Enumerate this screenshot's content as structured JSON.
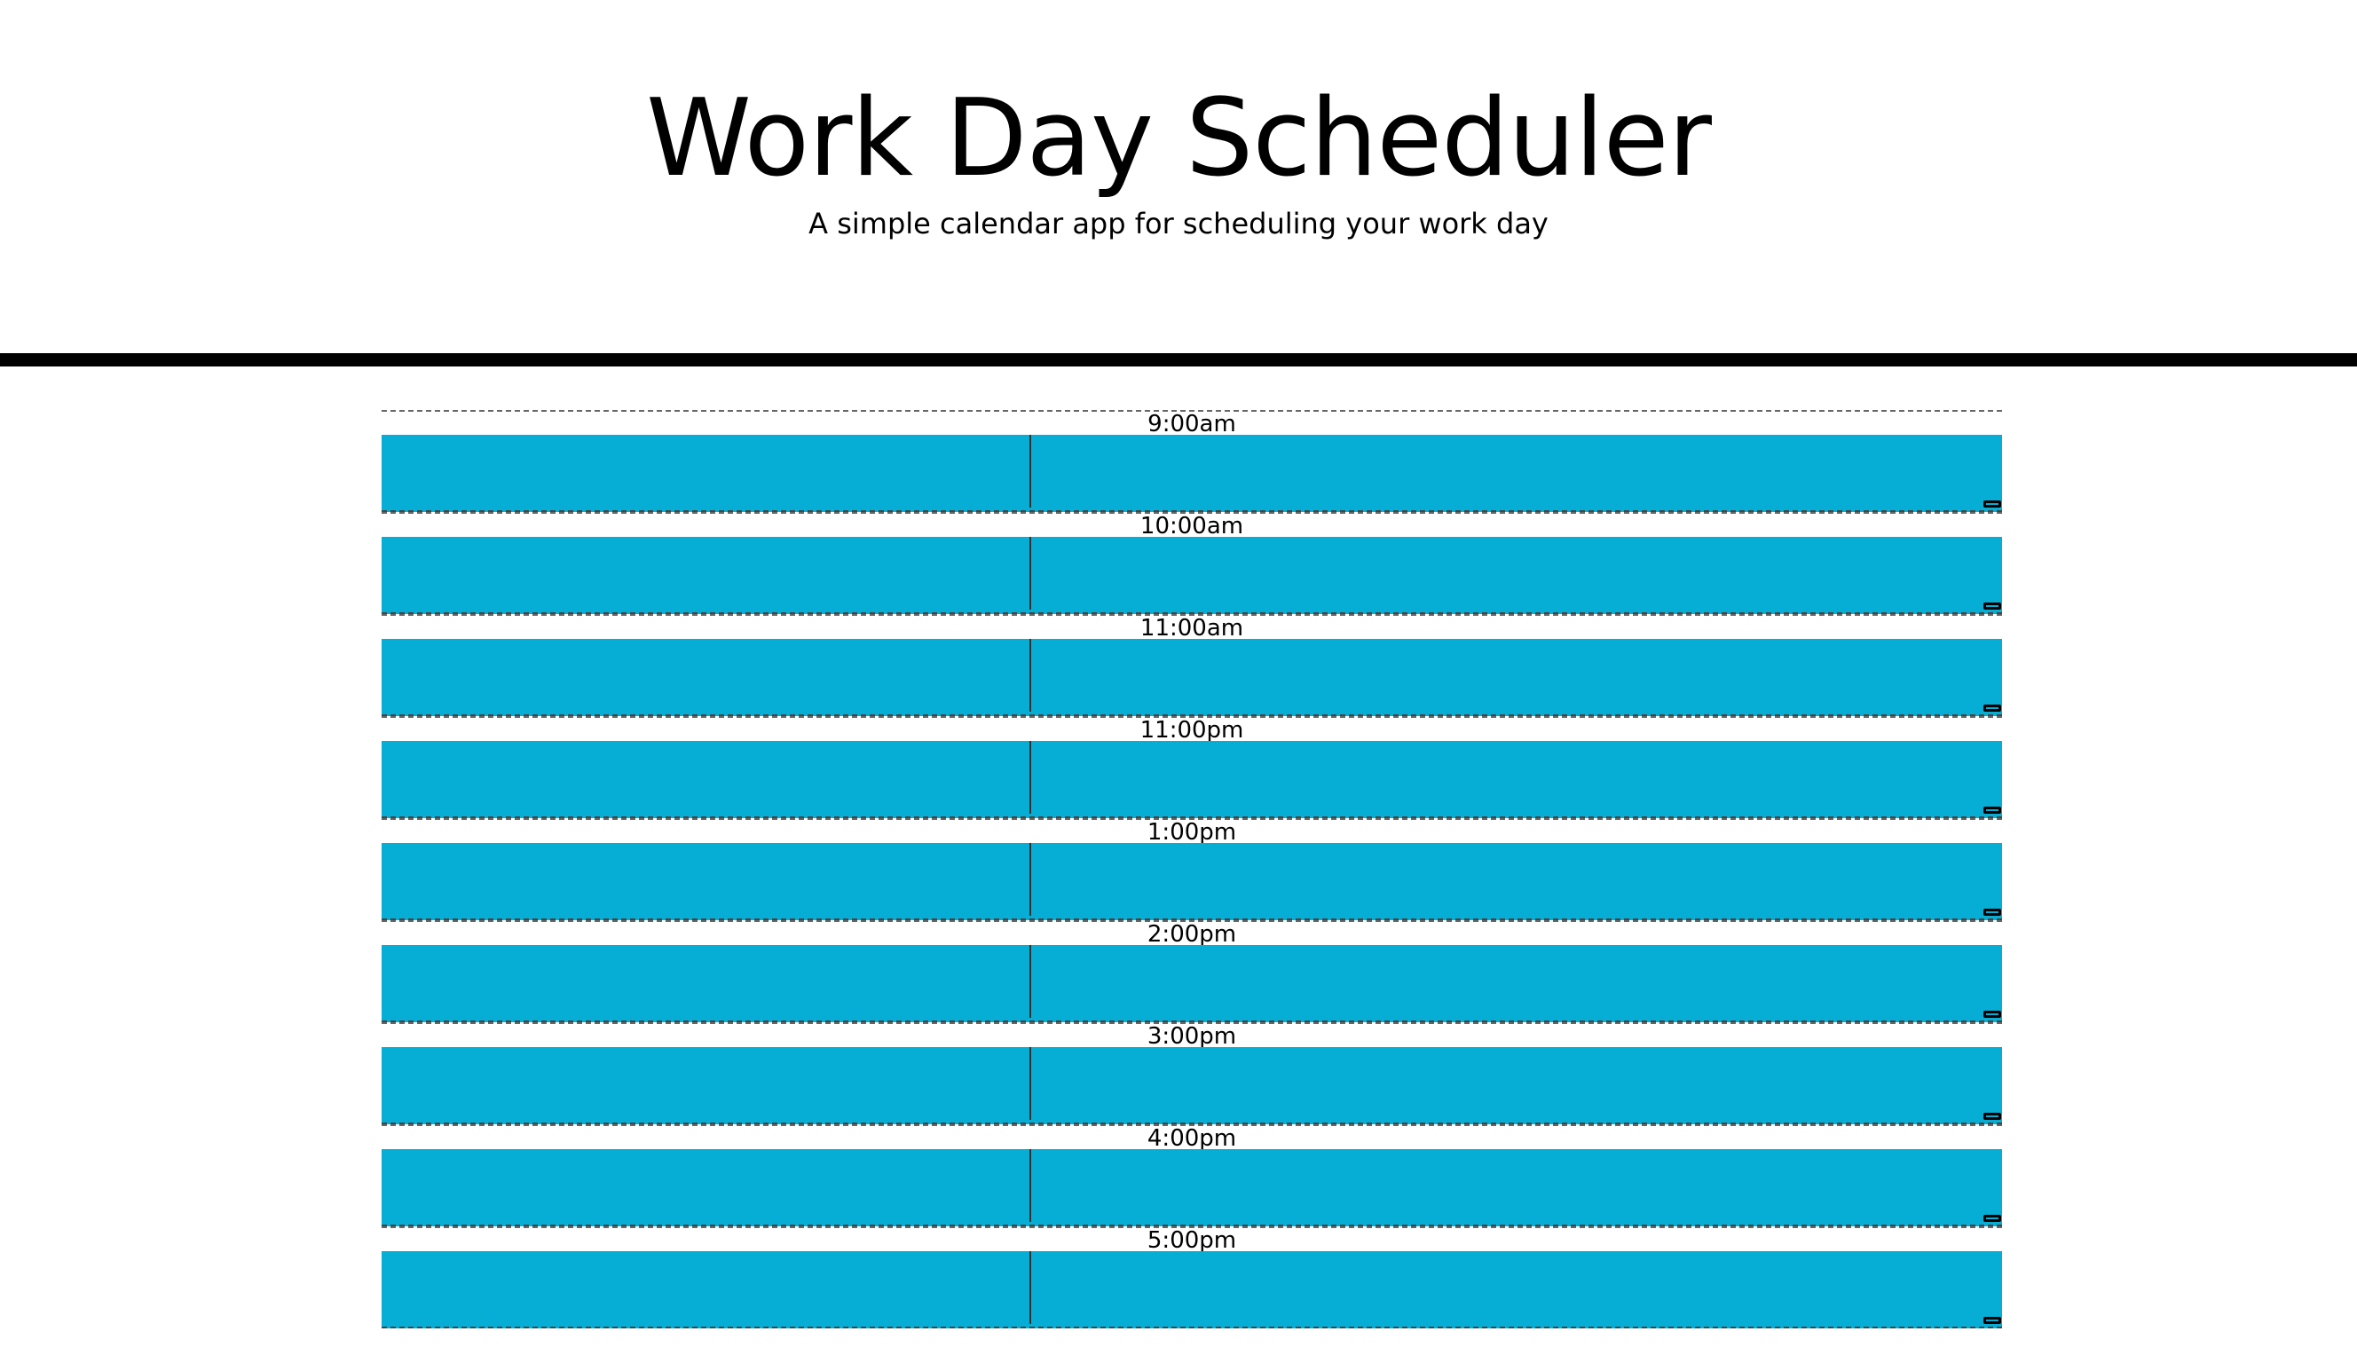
{
  "header": {
    "title": "Work Day Scheduler",
    "subtitle": "A simple calendar app for scheduling your work day"
  },
  "colors": {
    "block": "#06aed5",
    "divider": "#000000"
  },
  "time_blocks": [
    {
      "hour": "9:00am",
      "text": "",
      "icon": "save-icon"
    },
    {
      "hour": "10:00am",
      "text": "",
      "icon": "save-icon"
    },
    {
      "hour": "11:00am",
      "text": "",
      "icon": "save-icon"
    },
    {
      "hour": "11:00pm",
      "text": "",
      "icon": "save-icon"
    },
    {
      "hour": "1:00pm",
      "text": "",
      "icon": "save-icon"
    },
    {
      "hour": "2:00pm",
      "text": "",
      "icon": "save-icon"
    },
    {
      "hour": "3:00pm",
      "text": "",
      "icon": "save-icon"
    },
    {
      "hour": "4:00pm",
      "text": "",
      "icon": "save-icon"
    },
    {
      "hour": "5:00pm",
      "text": "",
      "icon": "save-icon"
    }
  ]
}
